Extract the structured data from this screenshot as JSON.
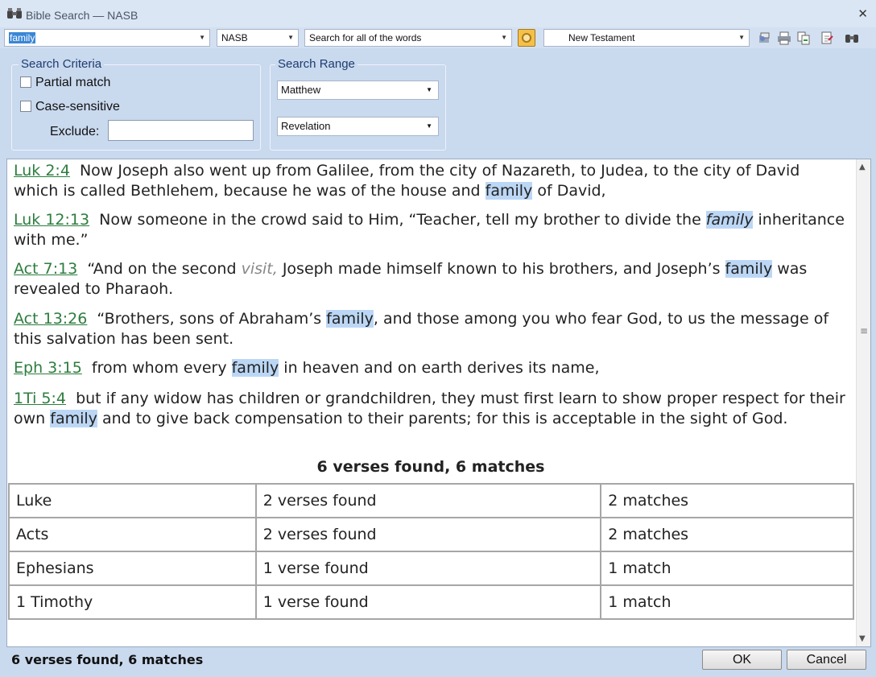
{
  "window": {
    "title": "Bible Search — NASB",
    "close_glyph": "✕"
  },
  "toolbar": {
    "search_value": "family",
    "version": "NASB",
    "search_mode": "Search for all of the words",
    "scope": "New Testament",
    "icons": [
      "options-gear-icon",
      "bookmark-icon",
      "print-icon",
      "copy-icon",
      "export-icon",
      "find-icon"
    ]
  },
  "criteria": {
    "title": "Search Criteria",
    "partial_match": "Partial match",
    "case_sensitive": "Case-sensitive",
    "exclude_label": "Exclude:",
    "exclude_value": ""
  },
  "range": {
    "title": "Search Range",
    "from": "Matthew",
    "to": "Revelation"
  },
  "verses": [
    {
      "ref": "Luk  2:4",
      "segments": [
        {
          "t": "Now Joseph also went up from Galilee, from the city of Nazareth, to Judea, to the city of David which is called Bethlehem, because he was of the house and "
        },
        {
          "t": "family",
          "s": "hl"
        },
        {
          "t": " of David,"
        }
      ]
    },
    {
      "ref": "Luk  12:13",
      "segments": [
        {
          "t": "Now someone in the crowd said to Him, “Teacher, tell my brother to divide the "
        },
        {
          "t": "family",
          "s": "hl ital"
        },
        {
          "t": " inheritance with me.”"
        }
      ]
    },
    {
      "ref": "Act  7:13",
      "segments": [
        {
          "t": "“And on the second "
        },
        {
          "t": "visit,",
          "s": "grey"
        },
        {
          "t": " Joseph made himself known to his brothers, and Joseph’s "
        },
        {
          "t": "family",
          "s": "hl"
        },
        {
          "t": " was revealed to Pharaoh."
        }
      ]
    },
    {
      "ref": "Act  13:26",
      "segments": [
        {
          "t": "“Brothers, sons of Abraham’s "
        },
        {
          "t": "family",
          "s": "hl"
        },
        {
          "t": ", and those among you who fear God, to us the message of this salvation has been sent."
        }
      ]
    },
    {
      "ref": "Eph  3:15",
      "segments": [
        {
          "t": "from whom every "
        },
        {
          "t": "family",
          "s": "hl"
        },
        {
          "t": " in heaven and on earth derives its name,"
        }
      ]
    },
    {
      "ref": "1Ti  5:4",
      "segments": [
        {
          "t": "but if any widow has children or grandchildren, they must first learn to show proper respect for their own "
        },
        {
          "t": "family",
          "s": "hl"
        },
        {
          "t": " and to give back compensation to their parents; for this is acceptable in the sight of God."
        }
      ]
    }
  ],
  "summary": {
    "title": "6 verses found, 6 matches",
    "rows": [
      [
        "Luke",
        "2 verses found",
        "2 matches"
      ],
      [
        "Acts",
        "2 verses found",
        "2 matches"
      ],
      [
        "Ephesians",
        "1 verse found",
        "1 match"
      ],
      [
        "1 Timothy",
        "1 verse found",
        "1 match"
      ]
    ]
  },
  "status": {
    "text": "6 verses found, 6 matches",
    "ok_label": "OK",
    "cancel_label": "Cancel"
  }
}
